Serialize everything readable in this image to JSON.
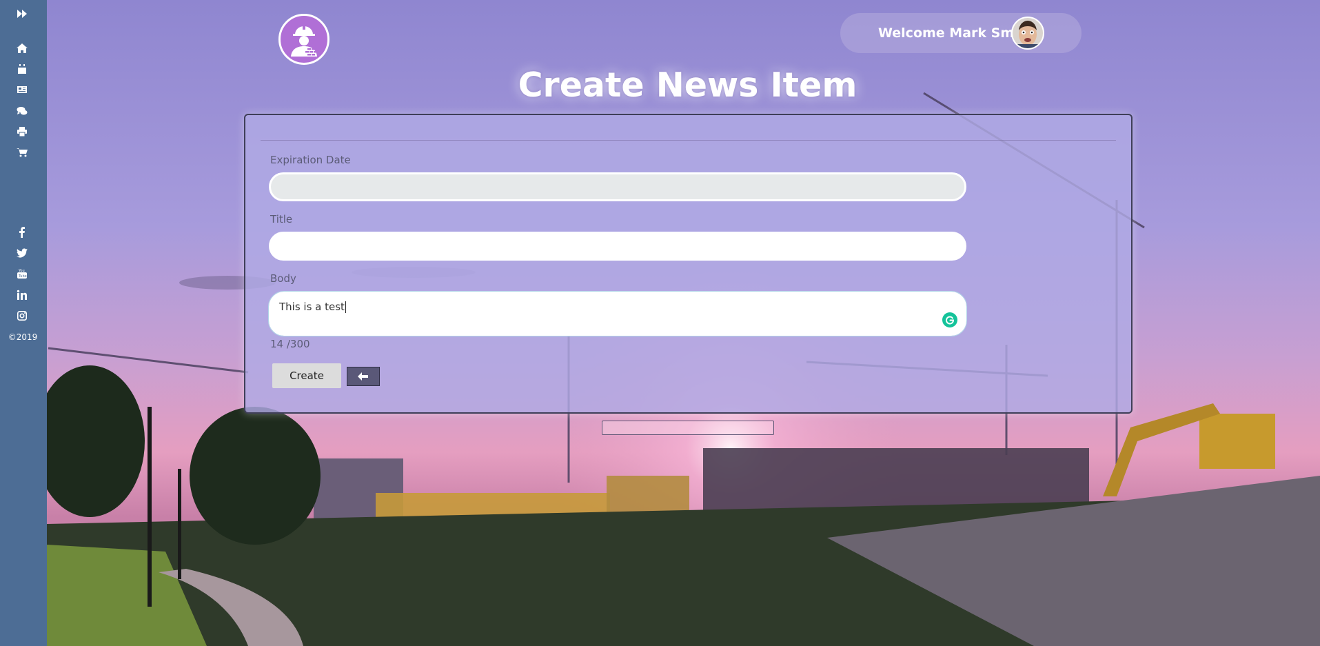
{
  "header": {
    "welcome_text": "Welcome Mark Smith",
    "page_title": "Create News Item"
  },
  "sidebar": {
    "nav_icons": [
      "forward-icon",
      "home-icon",
      "calendar-icon",
      "newspaper-icon",
      "comments-icon",
      "print-icon",
      "cart-icon"
    ],
    "social_icons": [
      "facebook-icon",
      "twitter-icon",
      "youtube-icon",
      "linkedin-icon",
      "instagram-icon"
    ],
    "copyright": "©2019"
  },
  "form": {
    "expiration_label": "Expiration Date",
    "expiration_value": "",
    "title_label": "Title",
    "title_value": "",
    "body_label": "Body",
    "body_value": "This is a test",
    "counter": "14 /300",
    "create_label": "Create"
  },
  "colors": {
    "sidebar": "#4d6d95",
    "logo": "#b06fd6",
    "card": "#b0aae4",
    "grammarly": "#15c39a"
  }
}
